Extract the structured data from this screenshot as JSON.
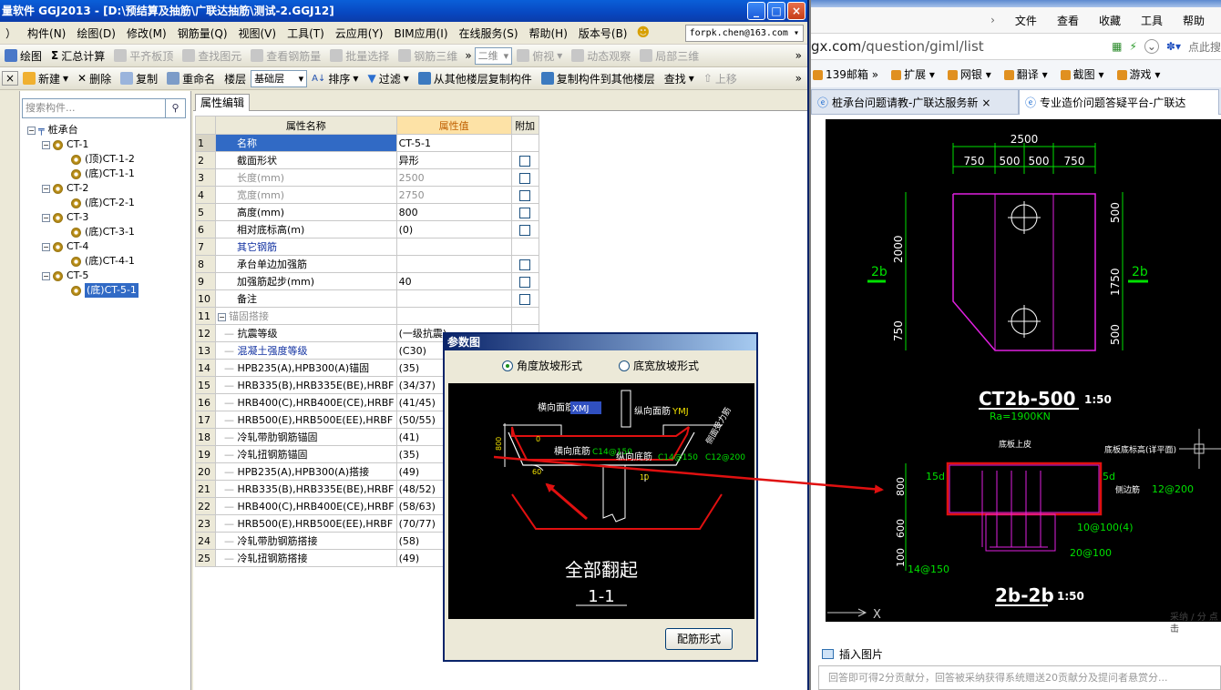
{
  "app": {
    "title": "量软件 GGJ2013 - [D:\\预结算及抽筋\\广联达抽筋\\测试-2.GGJ12]",
    "menu": [
      "）",
      "构件(N)",
      "绘图(D)",
      "修改(M)",
      "钢筋量(Q)",
      "视图(V)",
      "工具(T)",
      "云应用(Y)",
      "BIM应用(I)",
      "在线服务(S)",
      "帮助(H)",
      "版本号(B)"
    ],
    "account": "forpk.chen@163.com",
    "toolbar1": {
      "draw": "绘图",
      "sum": "汇总计算",
      "flat_top": "平齐板顶",
      "find_elem": "查找图元",
      "view_rebar": "查看钢筋量",
      "batch_select": "批量选择",
      "rebar_3d": "钢筋三维",
      "view_mode": "二维",
      "top_view": "俯视",
      "dynamic_view": "动态观察",
      "local_3d": "局部三维"
    },
    "toolbar2": {
      "new": "新建",
      "delete": "删除",
      "copy": "复制",
      "rename": "重命名",
      "floor_label": "楼层",
      "floor_value": "基础层",
      "sort": "排序",
      "filter": "过滤",
      "copy_from_floor": "从其他楼层复制构件",
      "copy_to_floor": "复制构件到其他楼层",
      "find": "查找",
      "move_up": "上移"
    },
    "search_placeholder": "搜索构件...",
    "tree": {
      "root": "桩承台",
      "groups": [
        {
          "name": "CT-1",
          "children": [
            "(顶)CT-1-2",
            "(底)CT-1-1"
          ]
        },
        {
          "name": "CT-2",
          "children": [
            "(底)CT-2-1"
          ]
        },
        {
          "name": "CT-3",
          "children": [
            "(底)CT-3-1"
          ]
        },
        {
          "name": "CT-4",
          "children": [
            "(底)CT-4-1"
          ]
        },
        {
          "name": "CT-5",
          "children": [
            "(底)CT-5-1"
          ]
        }
      ],
      "selected": "(底)CT-5-1"
    },
    "prop_tab": "属性编辑",
    "prop_headers": {
      "name": "属性名称",
      "value": "属性值",
      "extra": "附加"
    },
    "props": [
      {
        "n": "1",
        "name": "名称",
        "value": "CT-5-1",
        "cb": false,
        "style": "sel"
      },
      {
        "n": "2",
        "name": "截面形状",
        "value": "异形",
        "cb": true,
        "style": ""
      },
      {
        "n": "3",
        "name": "长度(mm)",
        "value": "2500",
        "cb": true,
        "style": "gray"
      },
      {
        "n": "4",
        "name": "宽度(mm)",
        "value": "2750",
        "cb": true,
        "style": "gray"
      },
      {
        "n": "5",
        "name": "高度(mm)",
        "value": "800",
        "cb": true,
        "style": ""
      },
      {
        "n": "6",
        "name": "相对底标高(m)",
        "value": "(0)",
        "cb": true,
        "style": ""
      },
      {
        "n": "7",
        "name": "其它钢筋",
        "value": "",
        "cb": false,
        "style": "blue"
      },
      {
        "n": "8",
        "name": "承台单边加强筋",
        "value": "",
        "cb": true,
        "style": ""
      },
      {
        "n": "9",
        "name": "加强筋起步(mm)",
        "value": "40",
        "cb": true,
        "style": ""
      },
      {
        "n": "10",
        "name": "备注",
        "value": "",
        "cb": true,
        "style": ""
      },
      {
        "n": "11",
        "name": "锚固搭接",
        "value": "",
        "cb": false,
        "style": "group"
      },
      {
        "n": "12",
        "name": "抗震等级",
        "value": "(一级抗震)",
        "cb": false,
        "style": "indent"
      },
      {
        "n": "13",
        "name": "混凝土强度等级",
        "value": "(C30)",
        "cb": false,
        "style": "indent blue"
      },
      {
        "n": "14",
        "name": "HPB235(A),HPB300(A)锚固",
        "value": "(35)",
        "cb": false,
        "style": "indent"
      },
      {
        "n": "15",
        "name": "HRB335(B),HRB335E(BE),HRBF",
        "value": "(34/37)",
        "cb": false,
        "style": "indent"
      },
      {
        "n": "16",
        "name": "HRB400(C),HRB400E(CE),HRBF",
        "value": "(41/45)",
        "cb": false,
        "style": "indent"
      },
      {
        "n": "17",
        "name": "HRB500(E),HRB500E(EE),HRBF",
        "value": "(50/55)",
        "cb": false,
        "style": "indent"
      },
      {
        "n": "18",
        "name": "冷轧带肋钢筋锚固",
        "value": "(41)",
        "cb": false,
        "style": "indent"
      },
      {
        "n": "19",
        "name": "冷轧扭钢筋锚固",
        "value": "(35)",
        "cb": false,
        "style": "indent"
      },
      {
        "n": "20",
        "name": "HPB235(A),HPB300(A)搭接",
        "value": "(49)",
        "cb": false,
        "style": "indent"
      },
      {
        "n": "21",
        "name": "HRB335(B),HRB335E(BE),HRBF",
        "value": "(48/52)",
        "cb": false,
        "style": "indent"
      },
      {
        "n": "22",
        "name": "HRB400(C),HRB400E(CE),HRBF",
        "value": "(58/63)",
        "cb": false,
        "style": "indent"
      },
      {
        "n": "23",
        "name": "HRB500(E),HRB500E(EE),HRBF",
        "value": "(70/77)",
        "cb": false,
        "style": "indent"
      },
      {
        "n": "24",
        "name": "冷轧带肋钢筋搭接",
        "value": "(58)",
        "cb": false,
        "style": "indent"
      },
      {
        "n": "25",
        "name": "冷轧扭钢筋搭接",
        "value": "(49)",
        "cb": false,
        "style": "indent"
      }
    ]
  },
  "dialog": {
    "title": "参数图",
    "radio1": "角度放坡形式",
    "radio2": "底宽放坡形式",
    "selected_radio": "角度放坡形式",
    "labels": {
      "h_top": "横向面筋",
      "h_top_val": "XMJ",
      "v_top": "纵向面筋",
      "v_top_val": "YMJ",
      "h_bot": "横向底筋",
      "h_bot_val": "C14@150",
      "v_bot": "纵向底筋",
      "v_bot_val": "C14@150",
      "side": "侧面受力筋",
      "side_val": "C12@200",
      "height": "800",
      "angle": "0",
      "slope": "60",
      "dim_i": "10"
    },
    "caption": "全部翻起",
    "section": "1-1",
    "button": "配筋形式"
  },
  "browser": {
    "menu": [
      "文件",
      "查看",
      "收藏",
      "工具",
      "帮助"
    ],
    "url_prefix": "gx.com",
    "url_path": "/question/giml/list",
    "bookmarks": [
      "139邮箱",
      "扩展",
      "网银",
      "翻译",
      "截图",
      "游戏"
    ],
    "search_hint": "点此搜",
    "tabs": [
      "桩承台问题请教-广联达服务新",
      "专业造价问题答疑平台-广联达"
    ],
    "insert_image": "插入图片",
    "answer_placeholder": "回答即可得2分贡献分，回答被采纳获得系统赠送20贡献分及提问者悬赏分...",
    "side_text": "采纳 / 分 点击"
  },
  "cad": {
    "dims_top": [
      "2500",
      "750",
      "500",
      "500",
      "750"
    ],
    "dims_left": [
      "2000",
      "750"
    ],
    "dims_right": [
      "500",
      "1750",
      "500"
    ],
    "section_mark": "2b",
    "plan_title": "CT2b-500",
    "plan_scale": "1:50",
    "plan_sub": "Ra=1900KN",
    "sec_left_dims": [
      "800",
      "600",
      "100"
    ],
    "sec_labels": {
      "bottom_up": "底板上皮",
      "base_elev": "底板底标高(详平面)",
      "side_rebar": "侧边筋",
      "side_val": "12@200",
      "l15d": "15d",
      "r5d": "5d",
      "r1": "10@100(4)",
      "r2": "20@100",
      "r3": "14@150"
    },
    "sec_title": "2b-2b",
    "sec_scale": "1:50",
    "axis_x": "X"
  },
  "colors": {
    "accent_red": "#e01010",
    "cad_green": "#00e000",
    "cad_magenta": "#e020e0",
    "cad_white": "#ffffff",
    "selection": "#316ac5"
  }
}
